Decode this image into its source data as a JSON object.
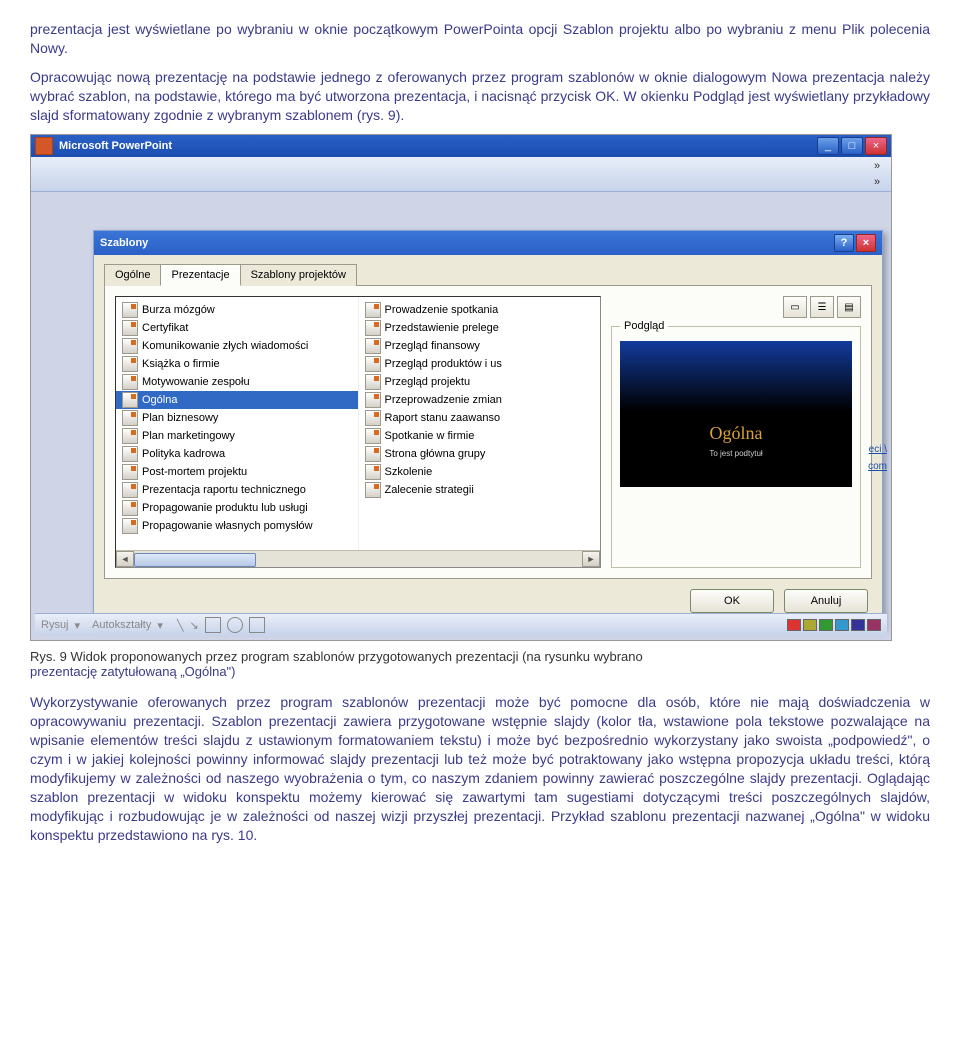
{
  "para1": "prezentacja jest wyświetlane po wybraniu w oknie początkowym PowerPointa opcji Szablon projektu albo po wybraniu z menu Plik polecenia Nowy.",
  "para2": "Opracowując nową prezentację na podstawie jednego z oferowanych przez program szablonów w oknie dialogowym Nowa prezentacja należy wybrać szablon, na podstawie, którego ma być utworzona prezentacja, i nacisnąć przycisk OK. W okienku Podgląd jest wyświetlany przykładowy slajd sformatowany zgodnie z wybranym szablonem (rys. 9).",
  "caption_lead": "Rys. 9 Widok proponowanych przez program szablonów przygotowanych prezentacji (na rysunku wybrano ",
  "caption_trail": "prezentację zatytułowaną „Ogólna\")",
  "para3": "Wykorzystywanie oferowanych przez program szablonów prezentacji może być pomocne dla osób, które nie mają doświadczenia w opracowywaniu prezentacji. Szablon prezentacji zawiera przygotowane wstępnie slajdy (kolor tła, wstawione pola tekstowe pozwalające na wpisanie elementów treści slajdu z ustawionym formatowaniem tekstu) i może być bezpośrednio wykorzystany jako swoista „podpowiedź\", o czym i w jakiej kolejności powinny informować slajdy prezentacji lub też może być potraktowany jako wstępna propozycja układu treści, którą modyfikujemy w zależności od naszego wyobrażenia o tym, co naszym zdaniem powinny zawierać poszczególne slajdy prezentacji. Oglądając szablon prezentacji w widoku konspektu możemy kierować się zawartymi tam sugestiami dotyczącymi treści poszczególnych slajdów, modyfikując i rozbudowując je w zależności od naszej wizji przyszłej prezentacji. Przykład szablonu prezentacji nazwanej „Ogólna\" w widoku konspektu przedstawiono na rys. 10.",
  "app": {
    "title": "Microsoft PowerPoint"
  },
  "dialog": {
    "title": "Szablony",
    "tabs": [
      "Ogólne",
      "Prezentacje",
      "Szablony projektów"
    ],
    "active_tab": 1,
    "col1": [
      "Burza mózgów",
      "Certyfikat",
      "Komunikowanie złych wiadomości",
      "Książka o firmie",
      "Motywowanie zespołu",
      "Ogólna",
      "Plan biznesowy",
      "Plan marketingowy",
      "Polityka kadrowa",
      "Post-mortem projektu",
      "Prezentacja raportu technicznego",
      "Propagowanie produktu lub usługi",
      "Propagowanie własnych pomysłów"
    ],
    "selected_col1": 5,
    "col2": [
      "Prowadzenie spotkania",
      "Przedstawienie prelege",
      "Przegląd finansowy",
      "Przegląd produktów i us",
      "Przegląd projektu",
      "Przeprowadzenie zmian",
      "Raport stanu zaawanso",
      "Spotkanie w firmie",
      "Strona główna grupy",
      "Szkolenie",
      "Zalecenie strategii"
    ],
    "preview_label": "Podgląd",
    "preview_title": "Ogólna",
    "preview_sub": "To jest podtytuł",
    "ok": "OK",
    "cancel": "Anuluj"
  },
  "drawbar": {
    "rysuj": "Rysuj",
    "autokszt": "Autokształty"
  },
  "taskpane": {
    "t1": "eci \\",
    "t2": "com"
  }
}
